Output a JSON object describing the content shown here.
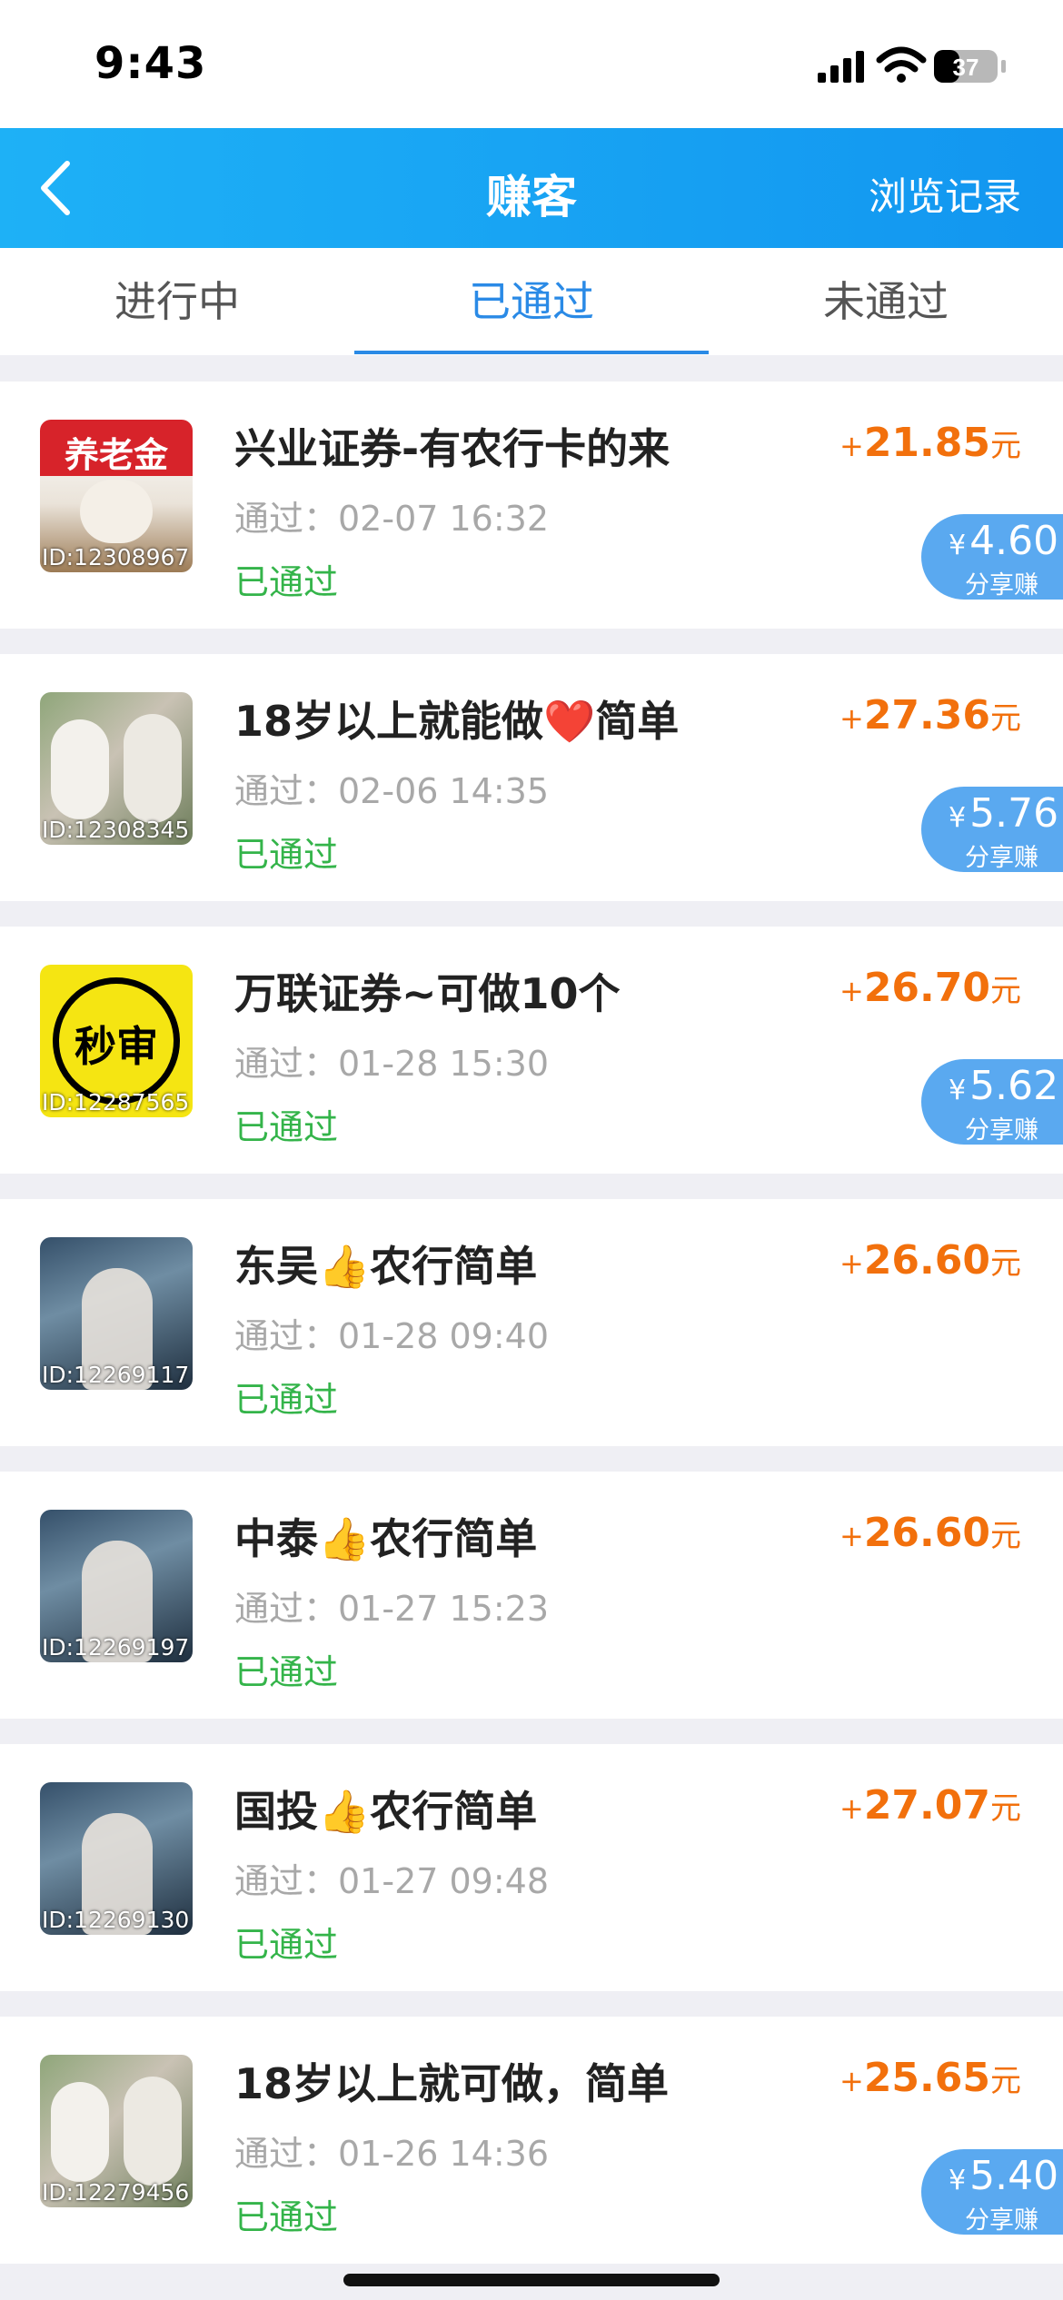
{
  "status_bar": {
    "time": "9:43",
    "battery": "37"
  },
  "nav": {
    "title": "赚客",
    "right_label": "浏览记录"
  },
  "tabs": [
    {
      "label": "进行中"
    },
    {
      "label": "已通过"
    },
    {
      "label": "未通过"
    }
  ],
  "active_tab": "已通过",
  "colors": {
    "nav_blue": "#1296f0",
    "accent_blue": "#2a8ae6",
    "reward_orange": "#f2700c",
    "status_green": "#34b44a",
    "share_badge": "#5aa9f0"
  },
  "tasks": [
    {
      "id": "ID:12308967",
      "thumb_text": "养老金",
      "title": "兴业证券-有农行卡的来",
      "time": "通过：02-07 16:32",
      "status": "已通过",
      "reward_sign": "+",
      "reward": "21.85",
      "reward_unit": "元",
      "share_yen": "¥",
      "share_amount": "4.60",
      "share_label": "分享赚"
    },
    {
      "id": "ID:12308345",
      "title": "18岁以上就能做❤️简单",
      "time": "通过：02-06 14:35",
      "status": "已通过",
      "reward_sign": "+",
      "reward": "27.36",
      "reward_unit": "元",
      "share_yen": "¥",
      "share_amount": "5.76",
      "share_label": "分享赚"
    },
    {
      "id": "ID:12287565",
      "thumb_text": "秒审",
      "title": "万联证券~可做10个",
      "time": "通过：01-28 15:30",
      "status": "已通过",
      "reward_sign": "+",
      "reward": "26.70",
      "reward_unit": "元",
      "share_yen": "¥",
      "share_amount": "5.62",
      "share_label": "分享赚"
    },
    {
      "id": "ID:12269117",
      "title": "东吴👍农行简单",
      "time": "通过：01-28 09:40",
      "status": "已通过",
      "reward_sign": "+",
      "reward": "26.60",
      "reward_unit": "元"
    },
    {
      "id": "ID:12269197",
      "title": "中泰👍农行简单",
      "time": "通过：01-27 15:23",
      "status": "已通过",
      "reward_sign": "+",
      "reward": "26.60",
      "reward_unit": "元"
    },
    {
      "id": "ID:12269130",
      "title": "国投👍农行简单",
      "time": "通过：01-27 09:48",
      "status": "已通过",
      "reward_sign": "+",
      "reward": "27.07",
      "reward_unit": "元"
    },
    {
      "id": "ID:12279456",
      "title": "18岁以上就可做，简单",
      "time": "通过：01-26 14:36",
      "status": "已通过",
      "reward_sign": "+",
      "reward": "25.65",
      "reward_unit": "元",
      "share_yen": "¥",
      "share_amount": "5.40",
      "share_label": "分享赚"
    }
  ]
}
